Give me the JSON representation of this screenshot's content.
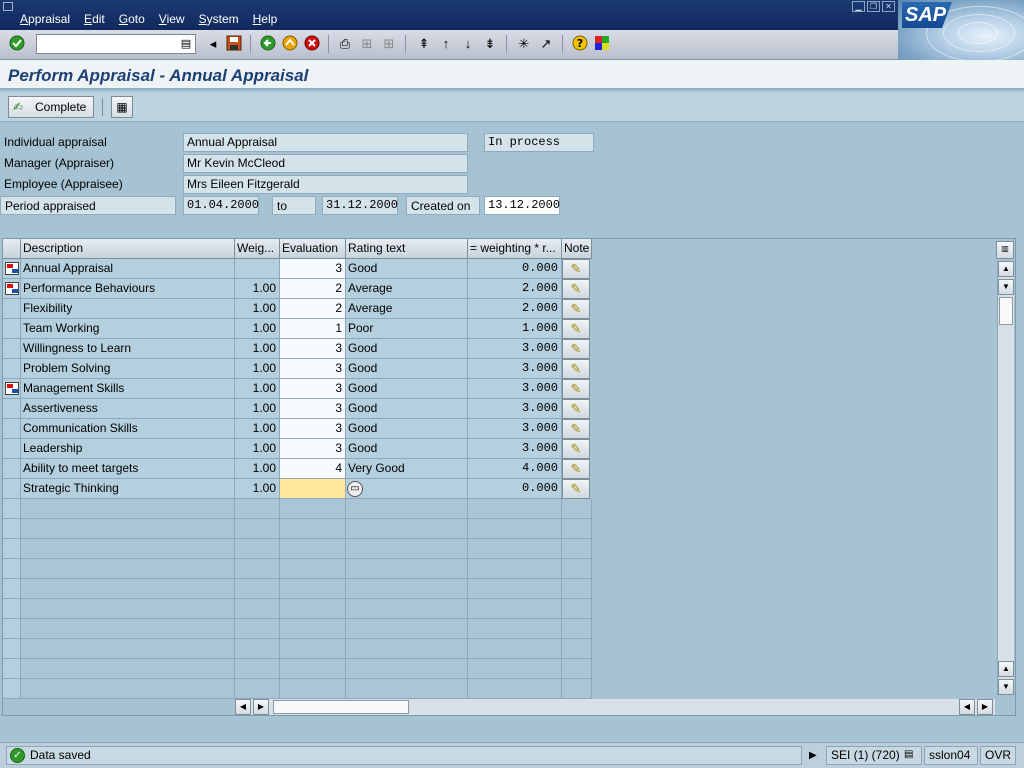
{
  "menu": {
    "items": [
      {
        "label": "Appraisal",
        "hotkey": "A",
        "rest": "ppraisal"
      },
      {
        "label": "Edit",
        "hotkey": "E",
        "rest": "dit"
      },
      {
        "label": "Goto",
        "hotkey": "G",
        "rest": "oto"
      },
      {
        "label": "View",
        "hotkey": "V",
        "rest": "iew"
      },
      {
        "label": "System",
        "hotkey": "S",
        "rest": "ystem"
      },
      {
        "label": "Help",
        "hotkey": "H",
        "rest": "elp"
      }
    ],
    "logo": "SAP"
  },
  "toolbar": {
    "command_value": ""
  },
  "title": "Perform Appraisal - Annual Appraisal",
  "app_toolbar": {
    "complete_label": "Complete"
  },
  "header": {
    "individual_appraisal_label": "Individual appraisal",
    "individual_appraisal_value": "Annual Appraisal",
    "status_value": "In process",
    "manager_label": "Manager (Appraiser)",
    "manager_value": "Mr Kevin McCleod",
    "employee_label": "Employee (Appraisee)",
    "employee_value": "Mrs Eileen Fitzgerald",
    "period_label": "Period appraised",
    "period_from": "01.04.2000",
    "to_label": "to",
    "period_to": "31.12.2000",
    "created_on_label": "Created on",
    "created_on_value": "13.12.2000"
  },
  "table": {
    "columns": [
      "Description",
      "Weig...",
      "Evaluation",
      "Rating text",
      "= weighting  * r...",
      "Note"
    ],
    "rows": [
      {
        "description": "Annual Appraisal",
        "weight": "",
        "evaluation": "3",
        "rating": "Good",
        "weighted": "0.000",
        "node": true
      },
      {
        "description": "Performance Behaviours",
        "weight": "1.00",
        "evaluation": "2",
        "rating": "Average",
        "weighted": "2.000",
        "node": true
      },
      {
        "description": "Flexibility",
        "weight": "1.00",
        "evaluation": "2",
        "rating": "Average",
        "weighted": "2.000",
        "node": false
      },
      {
        "description": "Team Working",
        "weight": "1.00",
        "evaluation": "1",
        "rating": "Poor",
        "weighted": "1.000",
        "node": false
      },
      {
        "description": "Willingness to Learn",
        "weight": "1.00",
        "evaluation": "3",
        "rating": "Good",
        "weighted": "3.000",
        "node": false
      },
      {
        "description": "Problem Solving",
        "weight": "1.00",
        "evaluation": "3",
        "rating": "Good",
        "weighted": "3.000",
        "node": false
      },
      {
        "description": "Management Skills",
        "weight": "1.00",
        "evaluation": "3",
        "rating": "Good",
        "weighted": "3.000",
        "node": true
      },
      {
        "description": "Assertiveness",
        "weight": "1.00",
        "evaluation": "3",
        "rating": "Good",
        "weighted": "3.000",
        "node": false
      },
      {
        "description": "Communication Skills",
        "weight": "1.00",
        "evaluation": "3",
        "rating": "Good",
        "weighted": "3.000",
        "node": false
      },
      {
        "description": "Leadership",
        "weight": "1.00",
        "evaluation": "3",
        "rating": "Good",
        "weighted": "3.000",
        "node": false
      },
      {
        "description": "Ability to meet targets",
        "weight": "1.00",
        "evaluation": "4",
        "rating": "Very Good",
        "weighted": "4.000",
        "node": false
      },
      {
        "description": "Strategic Thinking",
        "weight": "1.00",
        "evaluation": "",
        "rating": "",
        "weighted": "0.000",
        "node": false,
        "active": true
      }
    ]
  },
  "status": {
    "message": "Data saved",
    "system": "SEI (1) (720)",
    "server": "sslon04",
    "mode": "OVR"
  },
  "colors": {
    "menubar": "#10295c",
    "background": "#a6c3d3",
    "title": "#1d3f74",
    "active_cell": "#ffe99a",
    "ok": "#2e9b2b"
  }
}
